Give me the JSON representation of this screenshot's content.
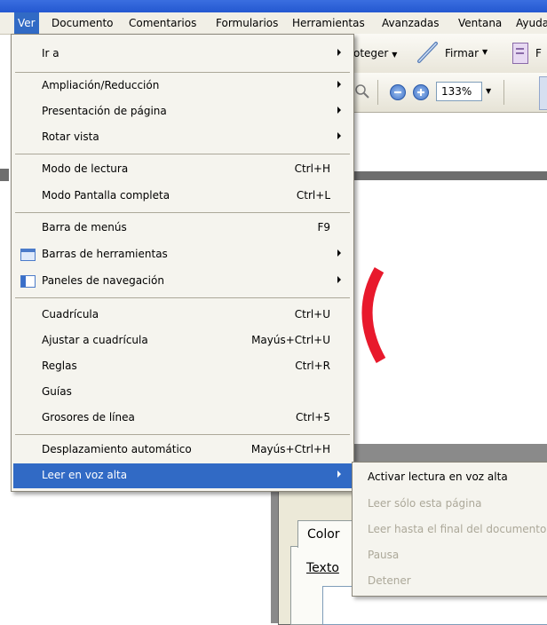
{
  "menubar": {
    "items": [
      "Ver",
      "Documento",
      "Comentarios",
      "Formularios",
      "Herramientas",
      "Avanzadas",
      "Ventana",
      "Ayuda"
    ]
  },
  "toolbar": {
    "proteger_partial": "oteger",
    "firmar": "Firmar",
    "zoom": "133%"
  },
  "view_menu": {
    "items": [
      {
        "label": "Ir a"
      },
      {
        "label": "Ampliación/Reducción"
      },
      {
        "label": "Presentación de página"
      },
      {
        "label": "Rotar vista"
      },
      {
        "label": "Modo de lectura",
        "shortcut": "Ctrl+H"
      },
      {
        "label": "Modo Pantalla completa",
        "shortcut": "Ctrl+L"
      },
      {
        "label": "Barra de menús",
        "shortcut": "F9"
      },
      {
        "label": "Barras de herramientas"
      },
      {
        "label": "Paneles de navegación"
      },
      {
        "label": "Cuadrícula",
        "shortcut": "Ctrl+U"
      },
      {
        "label": "Ajustar a cuadrícula",
        "shortcut": "Mayús+Ctrl+U"
      },
      {
        "label": "Reglas",
        "shortcut": "Ctrl+R"
      },
      {
        "label": "Guías"
      },
      {
        "label": "Grosores de línea",
        "shortcut": "Ctrl+5"
      },
      {
        "label": "Desplazamiento automático",
        "shortcut": "Mayús+Ctrl+H"
      },
      {
        "label": "Leer en voz alta"
      }
    ]
  },
  "read_aloud_submenu": {
    "items": [
      {
        "label": "Activar lectura en voz alta",
        "enabled": true
      },
      {
        "label": "Leer sólo esta página",
        "enabled": false
      },
      {
        "label": "Leer hasta el final del documento",
        "enabled": false
      },
      {
        "label": "Pausa",
        "enabled": false
      },
      {
        "label": "Detener",
        "enabled": false
      }
    ]
  },
  "dialog": {
    "tab_label": "Color",
    "field_label": "Texto"
  },
  "colors": {
    "highlight": "#316ac5",
    "menu_bg": "#f5f4ee",
    "disabled_text": "#aca899",
    "page_mark": "#e8192c"
  }
}
